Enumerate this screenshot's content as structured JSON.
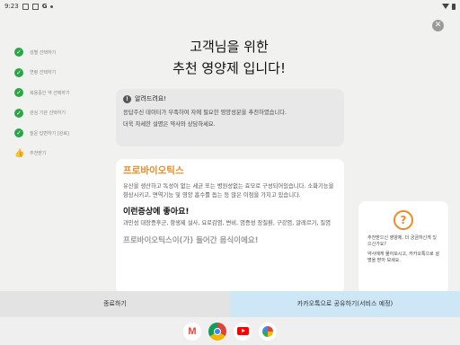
{
  "status_bar": {
    "time": "9:23",
    "g": "G"
  },
  "close_glyph": "✕",
  "steps": [
    {
      "label": "성별 선택하기",
      "done": true
    },
    {
      "label": "연령 선택하기",
      "done": true
    },
    {
      "label": "복용중인 약 선택하기",
      "done": true
    },
    {
      "label": "관심 기관 선택하기",
      "done": true
    },
    {
      "label": "질문 답변하기 [완료]",
      "done": true
    },
    {
      "label": "추천받기",
      "done": false
    }
  ],
  "title": {
    "line1": "고객님을 위한",
    "line2": "추천 영양제 입니다!"
  },
  "alert": {
    "heading": "알려드려요!",
    "text1": "응답주신 데이터가 부족하여 자에 필요한 영양성분을 추천하였습니다.",
    "text2": "더욱 자세한 설명은 약사와 상담하세요."
  },
  "card": {
    "title": "프로바이오틱스",
    "desc": "유산을 생산하고 독성이 없는 세균 또는 병원성없는 효모로 구성되어있습니다. 소화기능을 향상시키고, 면역기능 및 영양 흡수를 돕는 등 많은 이점을 가지고 있습니다.",
    "sym_title": "이런증상에 좋아요!",
    "sym_text": "과민성 대장증후군, 항생제 설사, 요로감염, 변비, 염증성 장질환, 구강염, 알레르기, 질염",
    "food_title": "프로바이오틱스이(가) 들어간 음식이에요!"
  },
  "side": {
    "q": "?",
    "text1": "추천받으신 영양제, 더 궁금하신게 있으신가요?",
    "text2": "약사에게 물어보시고, 카카오톡으로 설명을 받아 보세요."
  },
  "buttons": {
    "end": "종료하기",
    "share": "카카오톡으로 공유하기(서비스 예정)"
  },
  "taskbar": {
    "gmail": "M"
  },
  "colors": {
    "green": "#2aa548",
    "orange": "#f08a24",
    "share_bg": "#cde7f6"
  }
}
